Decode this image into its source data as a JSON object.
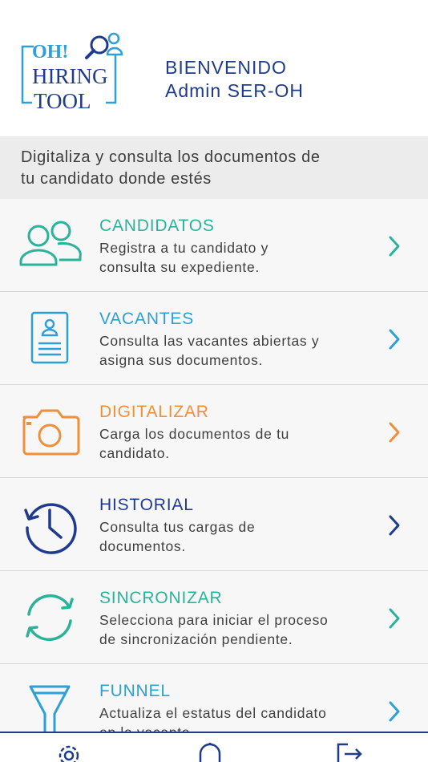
{
  "header": {
    "logo": {
      "line1": "OH!",
      "line2": "HIRING",
      "line3": "TOOL"
    },
    "welcome_line1": "BIENVENIDO",
    "welcome_line2": "Admin SER-OH"
  },
  "subtitle": {
    "line1": "Digitaliza y consulta los documentos de",
    "line2": "tu candidato donde estés"
  },
  "menu": {
    "items": [
      {
        "title": "CANDIDATOS",
        "desc_line1": "Registra a tu candidato y",
        "desc_line2": "consulta su expediente.",
        "color": "#2bb39a",
        "icon": "users-icon"
      },
      {
        "title": "VACANTES",
        "desc_line1": "Consulta las vacantes abiertas y",
        "desc_line2": "asigna sus documentos.",
        "color": "#2e9fd9",
        "icon": "id-card-icon"
      },
      {
        "title": "DIGITALIZAR",
        "desc_line1": "Carga los documentos de tu",
        "desc_line2": "candidato.",
        "color": "#f08f3a",
        "icon": "camera-icon"
      },
      {
        "title": "HISTORIAL",
        "desc_line1": "Consulta tus cargas de",
        "desc_line2": "documentos.",
        "color": "#1f3b8e",
        "icon": "history-clock-icon"
      },
      {
        "title": "SINCRONIZAR",
        "desc_line1": "Selecciona para iniciar el proceso",
        "desc_line2": "de sincronización pendiente.",
        "color": "#2bb39a",
        "icon": "sync-icon"
      },
      {
        "title": "FUNNEL",
        "desc_line1": "Actualiza el estatus del candidato",
        "desc_line2": "en la vacante.",
        "color": "#2e9fd9",
        "icon": "funnel-icon"
      }
    ]
  },
  "bottom_bar": {
    "icons": [
      "settings-gear-icon",
      "notification-bell-icon",
      "logout-icon"
    ],
    "color": "#1f3b8e"
  }
}
